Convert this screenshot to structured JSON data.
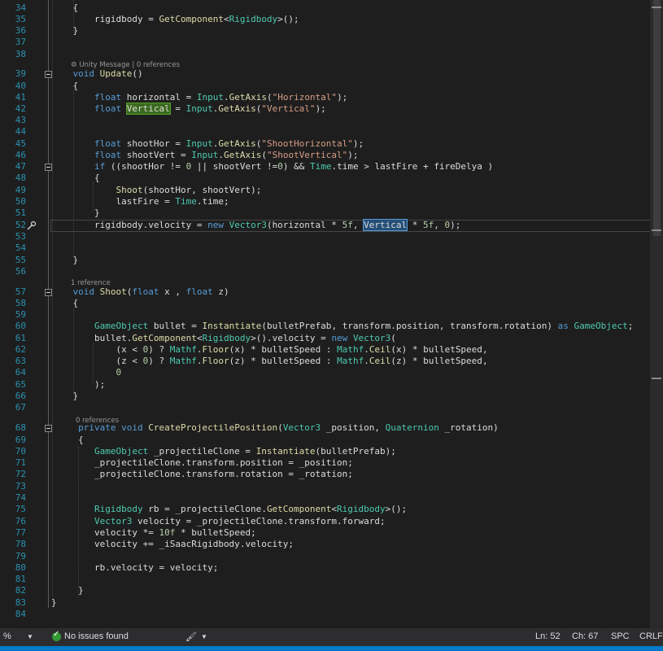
{
  "colors": {
    "background": "#1e1e1e",
    "keyword": "#569cd6",
    "type": "#4ec9b0",
    "method": "#dcdcaa",
    "string": "#d69d85",
    "number": "#b5cea8",
    "line_number": "#2b91af",
    "status_bar": "#2d2d30",
    "accent": "#007acc"
  },
  "code_lens": {
    "update": "⚙ Unity Message | 0 references",
    "shoot": "1 reference",
    "create": "0 references"
  },
  "lines": [
    {
      "n": "34",
      "t": "    {"
    },
    {
      "n": "35",
      "t": "        rigidbody = GetComponent<Rigidbody>();"
    },
    {
      "n": "36",
      "t": "    }"
    },
    {
      "n": "37",
      "t": ""
    },
    {
      "n": "38",
      "t": ""
    },
    {
      "n": "39",
      "t": "    void Update()"
    },
    {
      "n": "40",
      "t": "    {"
    },
    {
      "n": "41",
      "t": "        float horizontal = Input.GetAxis(\"Horizontal\");"
    },
    {
      "n": "42",
      "t": "        float Vertical = Input.GetAxis(\"Vertical\");"
    },
    {
      "n": "43",
      "t": ""
    },
    {
      "n": "44",
      "t": ""
    },
    {
      "n": "45",
      "t": "        float shootHor = Input.GetAxis(\"ShootHorizontal\");"
    },
    {
      "n": "46",
      "t": "        float shootVert = Input.GetAxis(\"ShootVertical\");"
    },
    {
      "n": "47",
      "t": "        if ((shootHor != 0 || shootVert !=0) && Time.time > lastFire + fireDelya )"
    },
    {
      "n": "48",
      "t": "        {"
    },
    {
      "n": "49",
      "t": "            Shoot(shootHor, shootVert);"
    },
    {
      "n": "50",
      "t": "            lastFire = Time.time;"
    },
    {
      "n": "51",
      "t": "        }"
    },
    {
      "n": "52",
      "t": "        rigidbody.velocity = new Vector3(horizontal * 5f, Vertical * 5f, 0);"
    },
    {
      "n": "53",
      "t": ""
    },
    {
      "n": "54",
      "t": ""
    },
    {
      "n": "55",
      "t": "    }"
    },
    {
      "n": "56",
      "t": ""
    },
    {
      "n": "57",
      "t": "    void Shoot(float x , float z)"
    },
    {
      "n": "58",
      "t": "    {"
    },
    {
      "n": "59",
      "t": ""
    },
    {
      "n": "60",
      "t": "        GameObject bullet = Instantiate(bulletPrefab, transform.position, transform.rotation) as GameObject;"
    },
    {
      "n": "61",
      "t": "        bullet.GetComponent<Rigidbody>().velocity = new Vector3("
    },
    {
      "n": "62",
      "t": "            (x < 0) ? Mathf.Floor(x) * bulletSpeed : Mathf.Ceil(x) * bulletSpeed,"
    },
    {
      "n": "63",
      "t": "            (z < 0) ? Mathf.Floor(z) * bulletSpeed : Mathf.Ceil(z) * bulletSpeed,"
    },
    {
      "n": "64",
      "t": "            0"
    },
    {
      "n": "65",
      "t": "        );"
    },
    {
      "n": "66",
      "t": "    }"
    },
    {
      "n": "67",
      "t": ""
    },
    {
      "n": "68",
      "t": "     private void CreateProjectilePosition(Vector3 _position, Quaternion _rotation)"
    },
    {
      "n": "69",
      "t": "     {"
    },
    {
      "n": "70",
      "t": "        GameObject _projectileClone = Instantiate(bulletPrefab);"
    },
    {
      "n": "71",
      "t": "        _projectileClone.transform.position = _position;"
    },
    {
      "n": "72",
      "t": "        _projectileClone.transform.rotation = _rotation;"
    },
    {
      "n": "73",
      "t": ""
    },
    {
      "n": "74",
      "t": ""
    },
    {
      "n": "75",
      "t": "        Rigidbody rb = _projectileClone.GetComponent<Rigidbody>();"
    },
    {
      "n": "76",
      "t": "        Vector3 velocity = _projectileClone.transform.forward;"
    },
    {
      "n": "77",
      "t": "        velocity *= 10f * bulletSpeed;"
    },
    {
      "n": "78",
      "t": "        velocity += _iSaacRigidbody.velocity;"
    },
    {
      "n": "79",
      "t": ""
    },
    {
      "n": "80",
      "t": "        rb.velocity = velocity;"
    },
    {
      "n": "81",
      "t": ""
    },
    {
      "n": "82",
      "t": "     }"
    },
    {
      "n": "83",
      "t": "}"
    },
    {
      "n": "84",
      "t": ""
    }
  ],
  "status": {
    "zoom": "%",
    "issues": "No issues found",
    "line": "Ln: 52",
    "column": "Ch: 67",
    "whitespace": "SPC",
    "line_ending": "CRLF"
  }
}
